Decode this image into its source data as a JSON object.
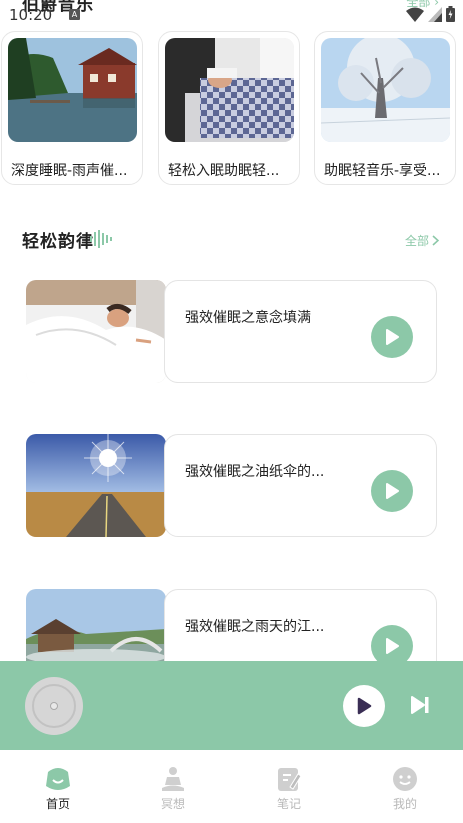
{
  "status": {
    "time": "10:20",
    "input_badge": "A"
  },
  "prev_section": {
    "title": "伯爵音乐",
    "more": "全部"
  },
  "top_cards": [
    {
      "title": "深度睡眠-雨声催..."
    },
    {
      "title": "轻松入眠助眠轻..."
    },
    {
      "title": "助眠轻音乐-享受..."
    }
  ],
  "section": {
    "title": "轻松韵律",
    "more": "全部"
  },
  "tracks": [
    {
      "title": "强效催眠之意念填满"
    },
    {
      "title": "强效催眠之油纸伞的..."
    },
    {
      "title": "强效催眠之雨天的江..."
    }
  ],
  "nav": [
    {
      "label": "首页",
      "active": true
    },
    {
      "label": "冥想",
      "active": false
    },
    {
      "label": "笔记",
      "active": false
    },
    {
      "label": "我的",
      "active": false
    }
  ],
  "colors": {
    "accent": "#8cc8a8",
    "play_icon": "#3a2e55"
  }
}
